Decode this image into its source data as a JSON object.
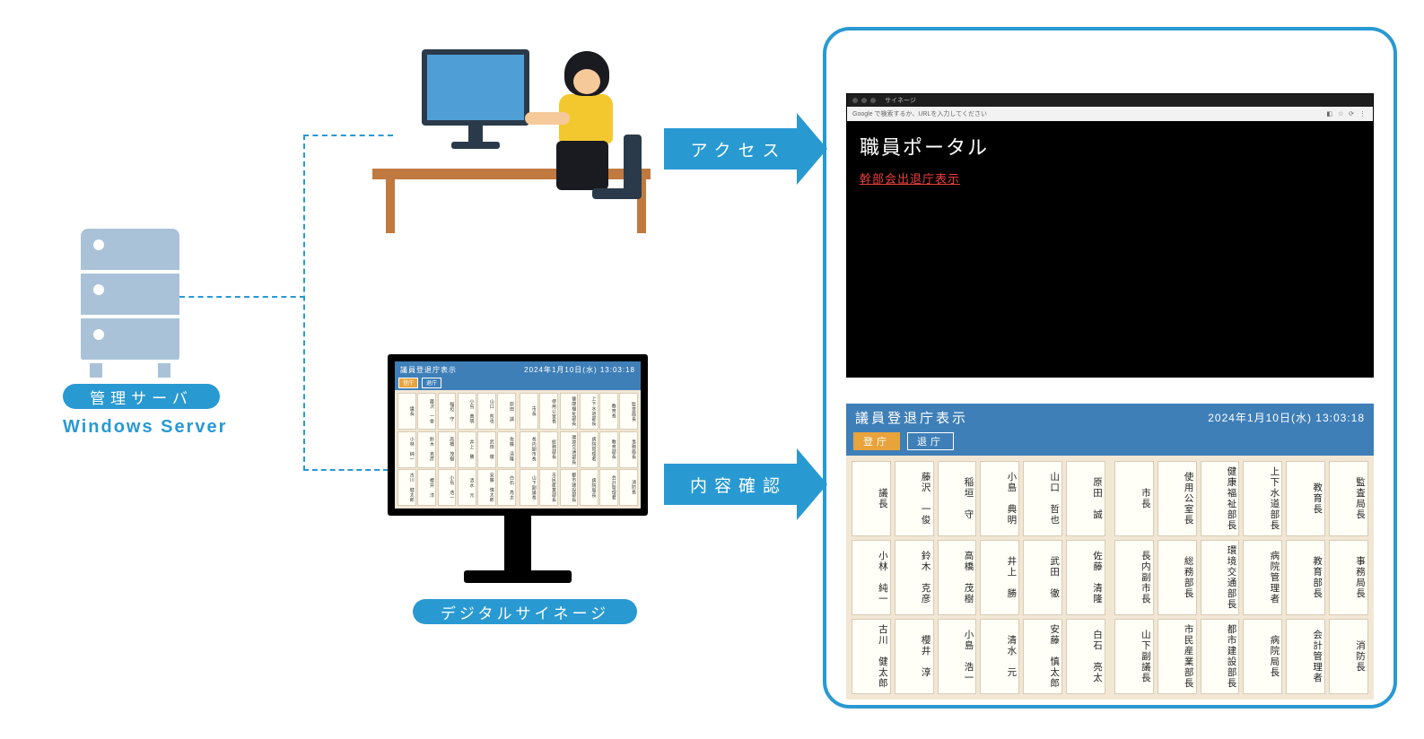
{
  "server": {
    "label": "管理サーバ",
    "subtitle": "Windows Server"
  },
  "signage": {
    "label": "デジタルサイネージ"
  },
  "arrows": {
    "access": "アクセス",
    "confirm": "内容確認"
  },
  "browser": {
    "addr_hint": "Google で検索するか、URLを入力してください",
    "tab_label": "サイネージ"
  },
  "portal": {
    "title": "職員ポータル",
    "link": "幹部会出退庁表示"
  },
  "board": {
    "title": "議員登退庁表示",
    "datetime": "2024年1月10日(水) 13:03:18",
    "btn_in": "登庁",
    "btn_out": "退庁",
    "left": [
      [
        "議長",
        "藤沢　一俊",
        "稲垣　守",
        "小島　典明",
        "山口　哲也",
        "原田　誠"
      ],
      [
        "小林　純一",
        "鈴木　克彦",
        "高橋　茂樹",
        "井上　勝",
        "武田　徹",
        "佐藤　清隆"
      ],
      [
        "古川　健太郎",
        "櫻井　淳",
        "小島　浩一",
        "清水　元",
        "安藤　慎太郎",
        "白石　亮太"
      ]
    ],
    "right": [
      [
        "市長",
        "使用公室長",
        "健康福祉部長",
        "上下水道部長",
        "教育長",
        "監査局長"
      ],
      [
        "長内副市長",
        "総務部長",
        "環境交通部長",
        "病院管理者",
        "教育部長",
        "事務局長"
      ],
      [
        "山下副議長",
        "市民産業部長",
        "都市建設部長",
        "病院局長",
        "会計管理者",
        "消防長"
      ]
    ]
  }
}
